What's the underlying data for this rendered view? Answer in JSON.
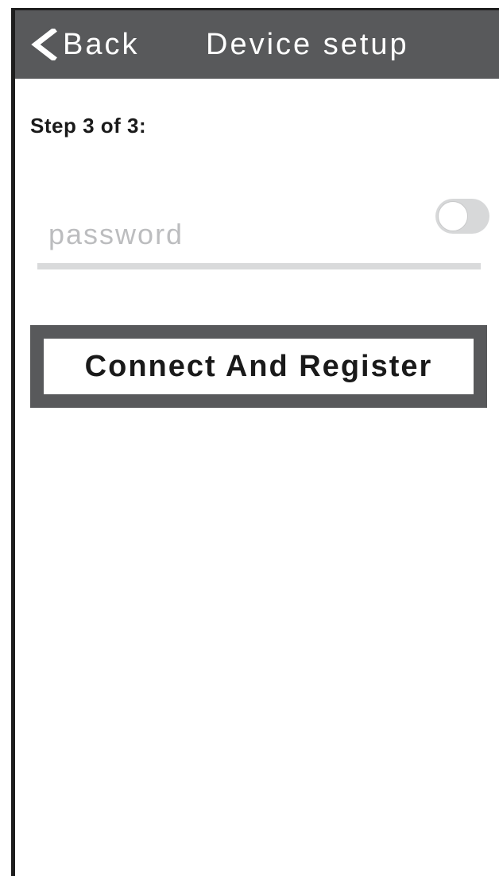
{
  "header": {
    "back_label": "Back",
    "back_icon": "chevron-left-icon",
    "title": "Device setup"
  },
  "step": {
    "text": "Step 3 of 3:"
  },
  "password": {
    "placeholder": "password",
    "value": "",
    "visibility_toggle_on": false
  },
  "connect": {
    "label": "Connect And Register"
  },
  "colors": {
    "header_bg": "#58595b",
    "header_text": "#ffffff",
    "placeholder": "#bcbdbf",
    "underline": "#d9dadb",
    "toggle_track": "#d7d8d9"
  }
}
